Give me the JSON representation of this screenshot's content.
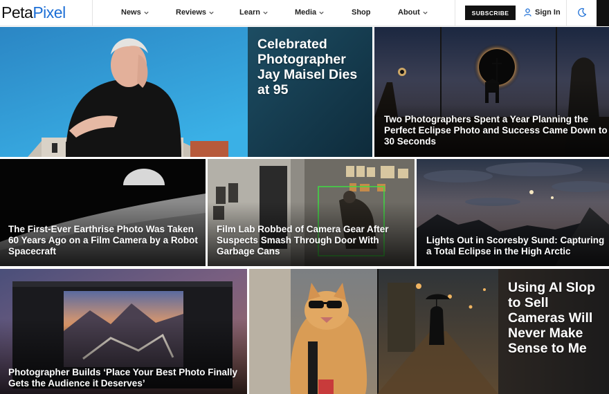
{
  "logo": {
    "part1": "Peta",
    "part2": "Pixel"
  },
  "nav": [
    {
      "label": "News",
      "dropdown": true
    },
    {
      "label": "Reviews",
      "dropdown": true
    },
    {
      "label": "Learn",
      "dropdown": true
    },
    {
      "label": "Media",
      "dropdown": true
    },
    {
      "label": "Shop",
      "dropdown": false
    },
    {
      "label": "About",
      "dropdown": true
    }
  ],
  "header": {
    "subscribe_label": "SUBSCRIBE",
    "signin_label": "Sign In"
  },
  "icons": {
    "user": "user-icon",
    "theme": "moon-icon",
    "chevron": "chevron-down-icon"
  },
  "colors": {
    "brand_blue": "#1d6fd6",
    "text_dark": "#222222",
    "header_black": "#111111"
  },
  "articles": [
    {
      "title": "Celebrated Photographer Jay Maisel Dies at 95"
    },
    {
      "title": "Two Photographers Spent a Year Planning the Perfect Eclipse Photo and Success Came Down to 30 Seconds"
    },
    {
      "title": "The First-Ever Earthrise Photo Was Taken 60 Years Ago on a Film Camera by a Robot Spacecraft"
    },
    {
      "title": "Film Lab Robbed of Camera Gear After Suspects Smash Through Door With Garbage Cans"
    },
    {
      "title": "Lights Out in Scoresby Sund: Capturing a Total Eclipse in the High Arctic"
    },
    {
      "title": "Photographer Builds ‘Place Your Best Photo Finally Gets the Audience it Deserves’"
    },
    {
      "title": "Using AI Slop to Sell Cameras Will Never Make Sense to Me"
    }
  ]
}
